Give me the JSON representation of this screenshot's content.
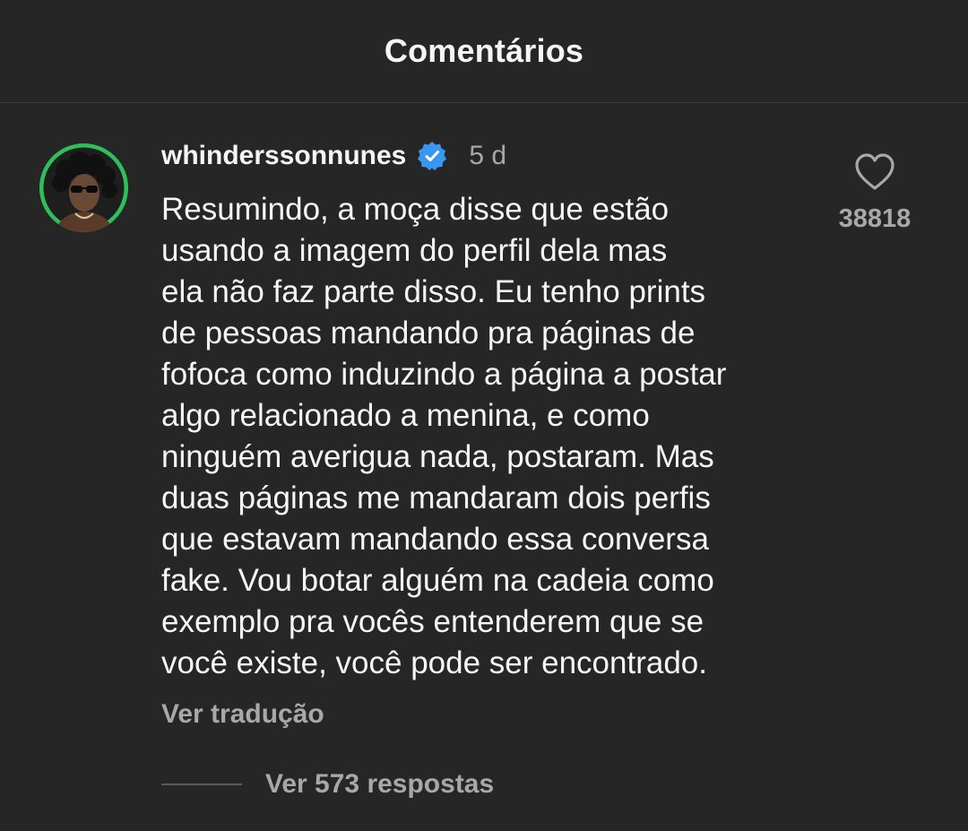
{
  "header": {
    "title": "Comentários"
  },
  "comment": {
    "avatar_icon": "profile-photo",
    "username": "whinderssonnunes",
    "verified_icon": "verified-badge-icon",
    "verified_color": "#3897f0",
    "time": "5 d",
    "text_lines": [
      "Resumindo, a moça disse que estão",
      "usando a imagem do perfil dela mas",
      "ela não faz parte disso. Eu tenho prints",
      "de pessoas mandando pra páginas de",
      "fofoca como induzindo a página a postar",
      "algo relacionado a menina, e como",
      "ninguém averigua nada, postaram. Mas",
      "duas páginas me mandaram dois perfis",
      "que estavam mandando essa conversa",
      "fake. Vou botar alguém na cadeia como",
      "exemplo pra vocês entenderem que se",
      "você existe, você pode ser encontrado."
    ],
    "translate_label": "Ver tradução",
    "like_icon": "heart-icon",
    "like_count": "38818",
    "replies_label": "Ver 573 respostas"
  },
  "colors": {
    "background": "#262626",
    "primary_text": "#f5f5f5",
    "secondary_text": "#a8a8a8",
    "avatar_ring": "#2fbf5a"
  }
}
